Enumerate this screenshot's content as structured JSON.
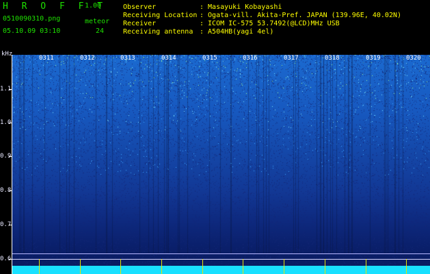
{
  "app": {
    "brand": "H R O F F T",
    "version": "1.00",
    "filename": "0510090310.png",
    "datetime": "05.10.09 03:10",
    "meteor_label": "meteor",
    "meteor_count": "24"
  },
  "meta": {
    "observer_label": "Observer",
    "observer_value": ": Masayuki Kobayashi",
    "location_label": "Receiving Location",
    "location_value": ": Ogata-vill. Akita-Pref. JAPAN (139.96E, 40.02N)",
    "receiver_label": "Receiver",
    "receiver_value": ": ICOM IC-575 53.7492(@LCD)MHz USB",
    "antenna_label": "Receiving antenna",
    "antenna_value": ": A504HB(yagi 4el)"
  },
  "axis": {
    "unit": "kHz",
    "y_labels": [
      "1.1",
      "1.0",
      "0.9",
      "0.8",
      "0.7",
      "0.6"
    ],
    "time_labels": [
      "0311",
      "0312",
      "0313",
      "0314",
      "0315",
      "0316",
      "0317",
      "0318",
      "0319",
      "0320"
    ]
  },
  "colors": {
    "header_text": "#1ee000",
    "meta_text": "#ffff00",
    "spectrum_top": "#1b6ad0",
    "spectrum_bottom": "#091a5e",
    "baseline": "#18e0ff"
  }
}
